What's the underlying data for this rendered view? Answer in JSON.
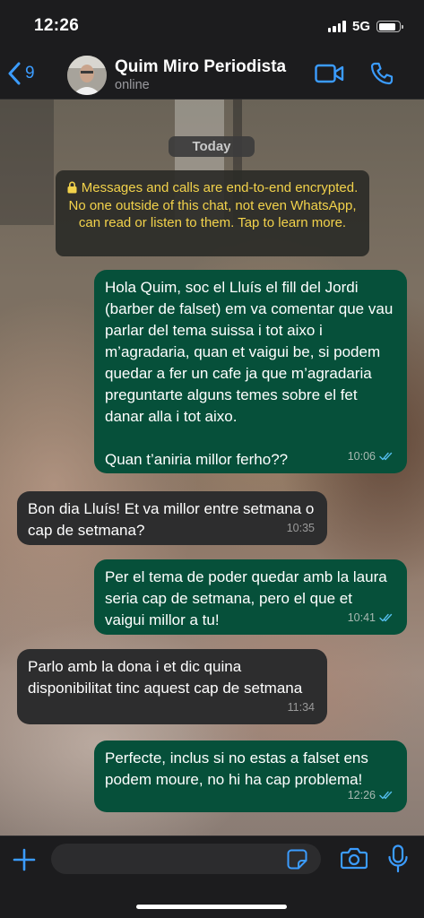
{
  "status_bar": {
    "time": "12:26",
    "network": "5G",
    "signal_bars": 4,
    "battery_level": 0.85
  },
  "header": {
    "back_count": "9",
    "contact_name": "Quim Miro Periodista",
    "contact_status": "online",
    "icons": [
      "chevron-left-icon",
      "video-camera-icon",
      "phone-icon"
    ]
  },
  "chat": {
    "date_label": "Today",
    "encryption_notice": "Messages and calls are end-to-end encrypted. No one outside of this chat, not even WhatsApp, can read or listen to them. Tap to learn more.",
    "messages": [
      {
        "direction": "out",
        "text": "Hola Quim, soc el Lluís el fill del Jordi (barber de falset) em va comentar que vau parlar del tema suissa i tot aixo i m’agradaria, quan et vaigui be, si podem quedar a fer un cafe ja que m’agradaria preguntarte alguns temes sobre el fet danar alla i tot aixo.\n\nQuan t’aniria millor ferho??",
        "time": "10:06",
        "read": true
      },
      {
        "direction": "in",
        "text": "Bon dia Lluís! Et va millor entre setmana o cap de setmana?",
        "time": "10:35"
      },
      {
        "direction": "out",
        "text": "Per el tema de poder quedar amb la laura seria cap de setmana, pero el que et vaigui millor a tu!",
        "time": "10:41",
        "read": true
      },
      {
        "direction": "in",
        "text": "Parlo amb la dona i et dic quina disponibilitat tinc aquest cap de setmana",
        "time": "11:34"
      },
      {
        "direction": "out",
        "text": "Perfecte, inclus si no estas a falset ens podem moure, no hi ha cap problema!",
        "time": "12:26",
        "read": true
      }
    ]
  },
  "input_bar": {
    "placeholder": "",
    "icons": [
      "plus-icon",
      "sticker-icon",
      "camera-icon",
      "microphone-icon"
    ]
  },
  "colors": {
    "accent": "#3b9cff",
    "outgoing_bubble": "#06503a",
    "incoming_bubble": "#2d2d2e",
    "encryption_text": "#f2d24b",
    "read_ticks": "#53bdeb"
  }
}
